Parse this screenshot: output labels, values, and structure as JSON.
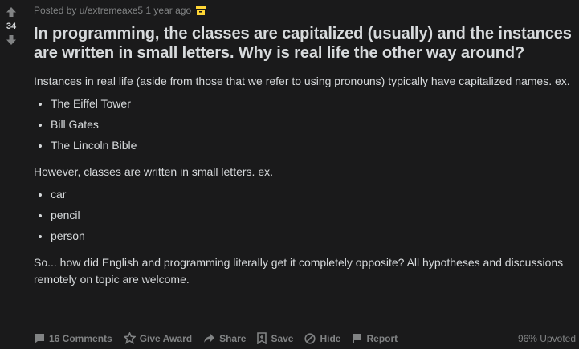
{
  "post": {
    "score": "34",
    "meta": "Posted by u/extremeaxe5 1 year ago",
    "title": "In programming, the classes are capitalized (usually) and the instances are written in small letters. Why is real life the other way around?",
    "intro": "Instances in real life (aside from those that we refer to using pronouns) typically have capitalized names. ex.",
    "instances": [
      "The Eiffel Tower",
      "Bill Gates",
      "The Lincoln Bible"
    ],
    "classes_intro": "However, classes are written in small letters. ex.",
    "classes": [
      "car",
      "pencil",
      "person"
    ],
    "closing": "So... how did English and programming literally get it completely opposite? All hypotheses and discussions remotely on topic are welcome."
  },
  "actions": {
    "comments": "16 Comments",
    "award": "Give Award",
    "share": "Share",
    "save": "Save",
    "hide": "Hide",
    "report": "Report",
    "upvoted": "96% Upvoted"
  },
  "colors": {
    "background": "#1a1a1b",
    "text": "#d7dadc",
    "muted": "#818384",
    "archive_icon": "#ffd635"
  }
}
